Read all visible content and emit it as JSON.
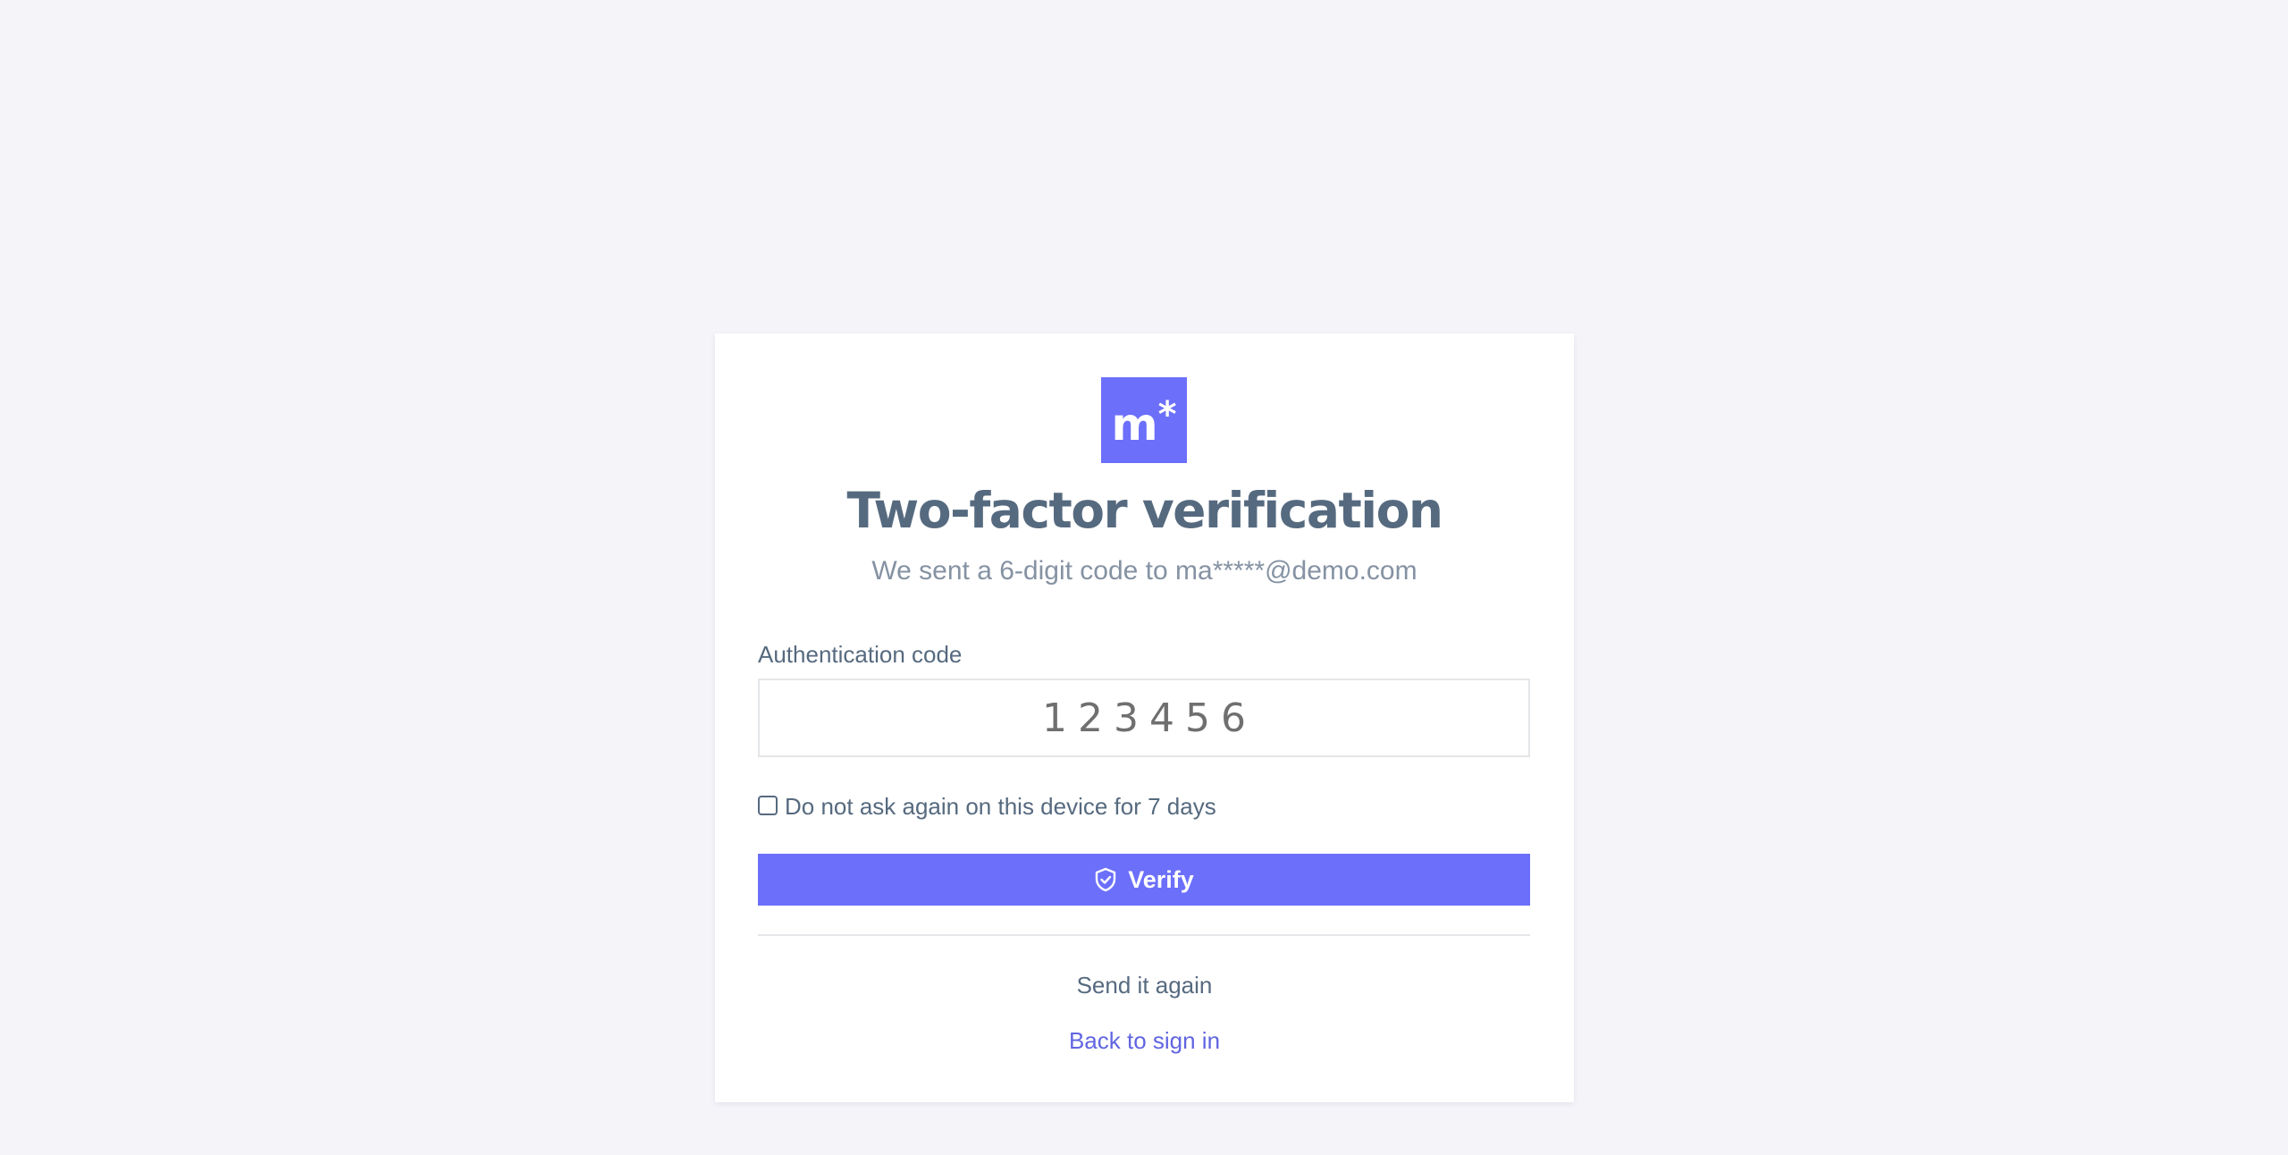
{
  "brand": {
    "logo_letter": "m",
    "logo_mark": "*",
    "logo_icon": "m-asterisk-logo",
    "accent_color": "#6c6ffa"
  },
  "header": {
    "title": "Two-factor verification",
    "subtitle": "We sent a 6-digit code to ma*****@demo.com"
  },
  "form": {
    "code_label": "Authentication code",
    "code_value": "123456",
    "remember_label": "Do not ask again on this device for 7 days",
    "remember_checked": false,
    "verify_label": "Verify",
    "verify_icon": "shield-check-icon"
  },
  "footer": {
    "resend_label": "Send it again",
    "back_label": "Back to sign in",
    "link_color": "#6065e0"
  }
}
